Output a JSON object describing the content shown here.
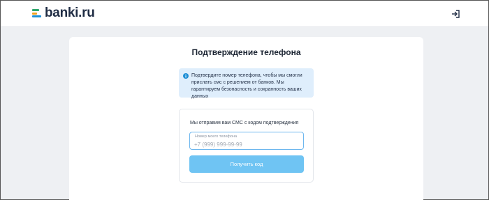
{
  "header": {
    "logo_text": "banki.ru",
    "login_icon": "login-icon"
  },
  "main": {
    "title": "Подтверждение телефона",
    "info": {
      "icon": "info-icon",
      "text": "Подтвердите номер телефона, чтобы мы смогли прислать смс с решением от банков. Мы гарантируем безопасность и сохранность ваших данных"
    },
    "form": {
      "caption": "Мы отправим вам СМС с кодом подтверждения",
      "phone_label": "Номер моего телефона",
      "phone_placeholder": "+7 (999) 999-99-99",
      "phone_value": "",
      "submit_label": "Получить код"
    }
  },
  "colors": {
    "accent": "#6fc4f3",
    "info_bg": "#dfeefc",
    "logo_green": "#2ea56b",
    "logo_orange": "#f2a21d",
    "logo_blue": "#1f8fd6"
  }
}
